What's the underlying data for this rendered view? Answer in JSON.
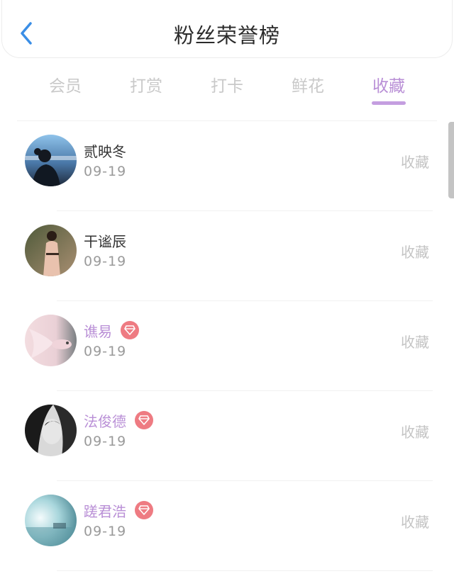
{
  "header": {
    "title": "粉丝荣誉榜",
    "back_icon": "chevron-left-icon"
  },
  "tabs": [
    {
      "label": "会员",
      "active": false
    },
    {
      "label": "打赏",
      "active": false
    },
    {
      "label": "打卡",
      "active": false
    },
    {
      "label": "鲜花",
      "active": false
    },
    {
      "label": "收藏",
      "active": true
    }
  ],
  "colors": {
    "accent": "#b98fd6",
    "badge": "#ee7b82",
    "back_arrow": "#3a8ee6"
  },
  "fans": [
    {
      "name": "贰映冬",
      "date": "09-19",
      "action": "收藏",
      "vip": false
    },
    {
      "name": "干谧辰",
      "date": "09-19",
      "action": "收藏",
      "vip": false
    },
    {
      "name": "谯易",
      "date": "09-19",
      "action": "收藏",
      "vip": true
    },
    {
      "name": "法俊德",
      "date": "09-19",
      "action": "收藏",
      "vip": true
    },
    {
      "name": "蹉君浩",
      "date": "09-19",
      "action": "收藏",
      "vip": true
    }
  ]
}
